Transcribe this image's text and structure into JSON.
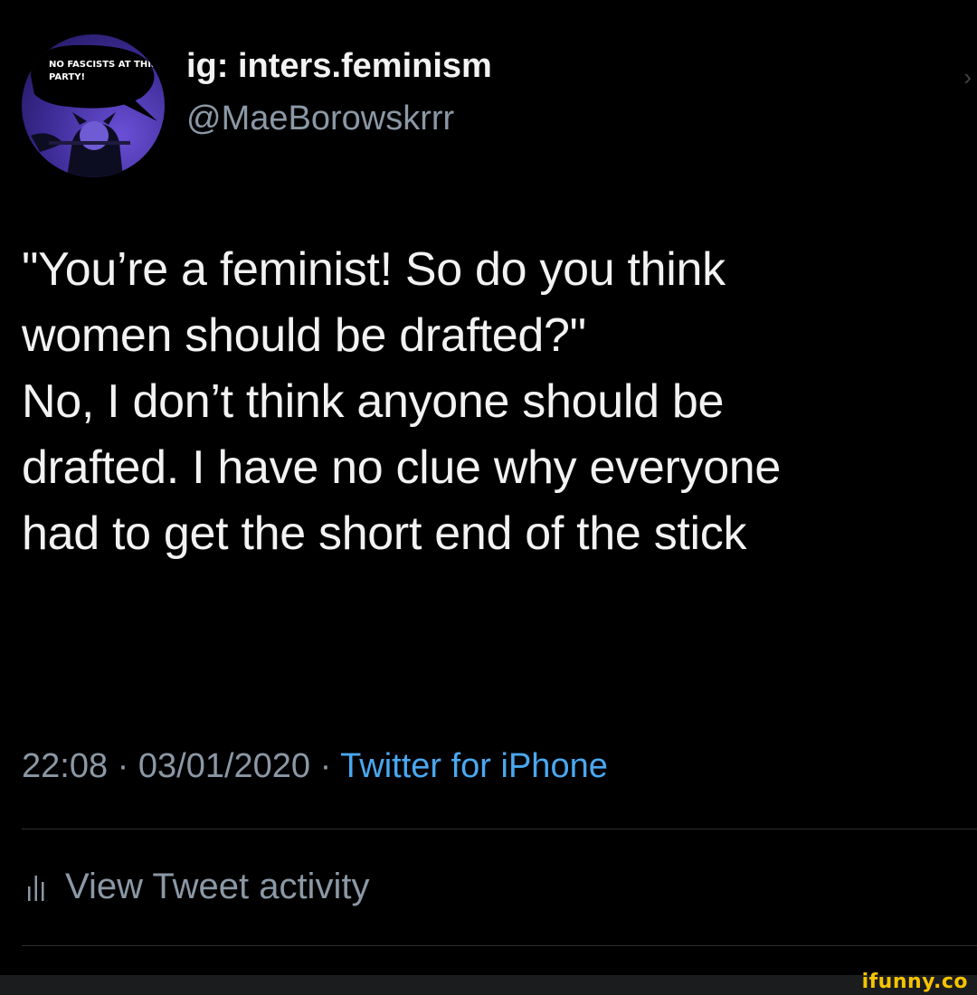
{
  "profile": {
    "display_name": "ig: inters.feminism",
    "handle": "@MaeBorowskrrr",
    "avatar_text": "NO FASCISTS AT THIS PARTY!"
  },
  "tweet": {
    "lines": [
      "\"You’re a feminist! So do you think",
      "women should be drafted?\"",
      "No, I don’t think anyone should be",
      "drafted. I have no clue why everyone",
      "had to get the short end of the stick"
    ]
  },
  "meta": {
    "time": "22:08",
    "separator": "·",
    "date": "03/01/2020",
    "source": "Twitter for iPhone"
  },
  "activity": {
    "label": "View Tweet activity",
    "icon": "bar-chart-icon"
  },
  "watermark": "ifunny.co",
  "colors": {
    "background": "#000000",
    "text": "#f2f2f2",
    "muted": "#8b98a5",
    "link": "#4aa8f0",
    "watermark": "#f5c400"
  }
}
